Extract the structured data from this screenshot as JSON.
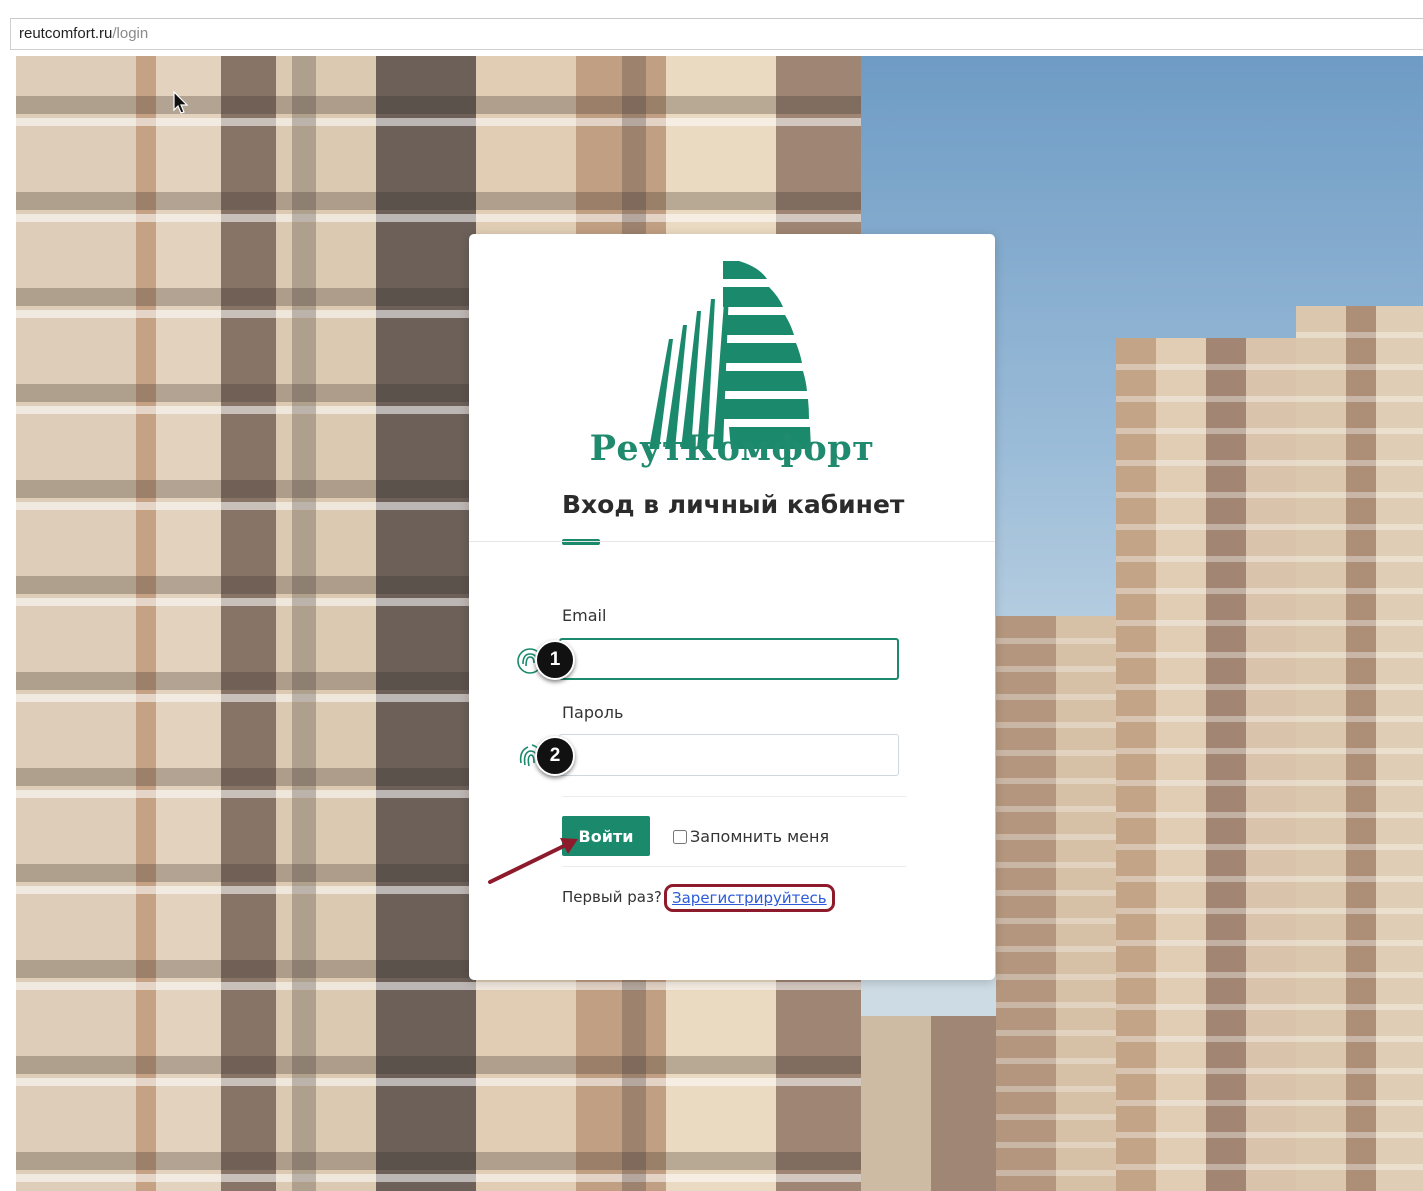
{
  "browser": {
    "url_host": "reutcomfort.ru",
    "url_path": "/login"
  },
  "login": {
    "brand": "РеутКомфорт",
    "title": "Вход в личный кабинет",
    "email_label": "Email",
    "email_value": "",
    "password_label": "Пароль",
    "password_value": "",
    "submit_label": "Войти",
    "remember_label": "Запомнить меня",
    "remember_checked": false,
    "first_time_text": "Первый раз?",
    "register_link": "Зарегистрируйтесь"
  },
  "annotations": {
    "step1": "1",
    "step2": "2"
  },
  "colors": {
    "brand_green": "#1b8a6c",
    "highlight_red": "#8e1b2c",
    "link_blue": "#2b5bd7"
  },
  "icons": [
    "fingerprint-icon",
    "mouse-cursor-icon",
    "arrow-annotation-icon"
  ]
}
